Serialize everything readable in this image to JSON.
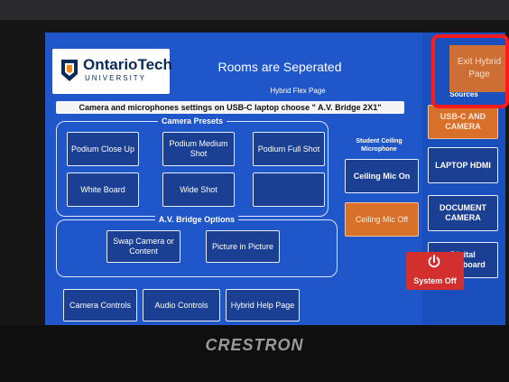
{
  "brand": {
    "device": "CRESTRON"
  },
  "header": {
    "logo_text": "OntarioTech",
    "logo_sub": "UNIVERSITY",
    "title": "Rooms are Seperated",
    "subtitle": "Hybrid Flex Page",
    "notice": "Camera and microphones settings on USB-C laptop choose \" A.V. Bridge 2X1\""
  },
  "camera_presets": {
    "label": "Camera Presets",
    "buttons": [
      "Podium Close Up",
      "Podium Medium Shot",
      "Podium Full Shot",
      "White Board",
      "Wide Shot",
      ""
    ]
  },
  "microphone": {
    "label": "Student Ceiling Microphone",
    "on": "Ceiling Mic On",
    "off": "Ceiling Mic Off"
  },
  "av_bridge": {
    "label": "A.V. Bridge Options",
    "swap": "Swap Camera or Content",
    "pip": "Picture in Picture"
  },
  "bottom": {
    "camera_controls": "Camera Controls",
    "audio_controls": "Audio Controls",
    "hybrid_help": "Hybrid Help Page"
  },
  "sources": {
    "label": "Sources",
    "usb_c": "USB-C AND CAMERA",
    "laptop": "LAPTOP HDMI",
    "document": "DOCUMENT CAMERA",
    "digital": "Digital Whiteboard"
  },
  "exit": {
    "label": "Exit Hybrid Page"
  },
  "system_off": {
    "label": "System Off"
  },
  "colors": {
    "screen": "#1f56c9",
    "active": "#d9702a",
    "alert": "#d32f2f",
    "highlight": "#ff1b1b"
  }
}
